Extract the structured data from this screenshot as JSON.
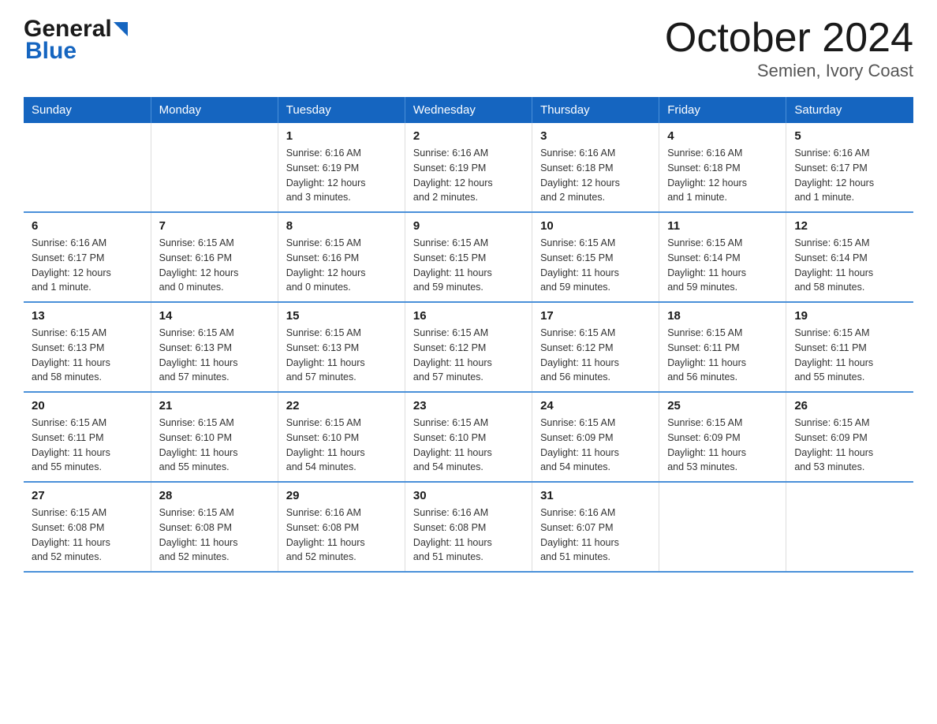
{
  "logo": {
    "general": "General",
    "triangle_char": "▶",
    "blue": "Blue"
  },
  "title": "October 2024",
  "location": "Semien, Ivory Coast",
  "weekdays": [
    "Sunday",
    "Monday",
    "Tuesday",
    "Wednesday",
    "Thursday",
    "Friday",
    "Saturday"
  ],
  "weeks": [
    [
      {
        "day": "",
        "info": ""
      },
      {
        "day": "",
        "info": ""
      },
      {
        "day": "1",
        "info": "Sunrise: 6:16 AM\nSunset: 6:19 PM\nDaylight: 12 hours\nand 3 minutes."
      },
      {
        "day": "2",
        "info": "Sunrise: 6:16 AM\nSunset: 6:19 PM\nDaylight: 12 hours\nand 2 minutes."
      },
      {
        "day": "3",
        "info": "Sunrise: 6:16 AM\nSunset: 6:18 PM\nDaylight: 12 hours\nand 2 minutes."
      },
      {
        "day": "4",
        "info": "Sunrise: 6:16 AM\nSunset: 6:18 PM\nDaylight: 12 hours\nand 1 minute."
      },
      {
        "day": "5",
        "info": "Sunrise: 6:16 AM\nSunset: 6:17 PM\nDaylight: 12 hours\nand 1 minute."
      }
    ],
    [
      {
        "day": "6",
        "info": "Sunrise: 6:16 AM\nSunset: 6:17 PM\nDaylight: 12 hours\nand 1 minute."
      },
      {
        "day": "7",
        "info": "Sunrise: 6:15 AM\nSunset: 6:16 PM\nDaylight: 12 hours\nand 0 minutes."
      },
      {
        "day": "8",
        "info": "Sunrise: 6:15 AM\nSunset: 6:16 PM\nDaylight: 12 hours\nand 0 minutes."
      },
      {
        "day": "9",
        "info": "Sunrise: 6:15 AM\nSunset: 6:15 PM\nDaylight: 11 hours\nand 59 minutes."
      },
      {
        "day": "10",
        "info": "Sunrise: 6:15 AM\nSunset: 6:15 PM\nDaylight: 11 hours\nand 59 minutes."
      },
      {
        "day": "11",
        "info": "Sunrise: 6:15 AM\nSunset: 6:14 PM\nDaylight: 11 hours\nand 59 minutes."
      },
      {
        "day": "12",
        "info": "Sunrise: 6:15 AM\nSunset: 6:14 PM\nDaylight: 11 hours\nand 58 minutes."
      }
    ],
    [
      {
        "day": "13",
        "info": "Sunrise: 6:15 AM\nSunset: 6:13 PM\nDaylight: 11 hours\nand 58 minutes."
      },
      {
        "day": "14",
        "info": "Sunrise: 6:15 AM\nSunset: 6:13 PM\nDaylight: 11 hours\nand 57 minutes."
      },
      {
        "day": "15",
        "info": "Sunrise: 6:15 AM\nSunset: 6:13 PM\nDaylight: 11 hours\nand 57 minutes."
      },
      {
        "day": "16",
        "info": "Sunrise: 6:15 AM\nSunset: 6:12 PM\nDaylight: 11 hours\nand 57 minutes."
      },
      {
        "day": "17",
        "info": "Sunrise: 6:15 AM\nSunset: 6:12 PM\nDaylight: 11 hours\nand 56 minutes."
      },
      {
        "day": "18",
        "info": "Sunrise: 6:15 AM\nSunset: 6:11 PM\nDaylight: 11 hours\nand 56 minutes."
      },
      {
        "day": "19",
        "info": "Sunrise: 6:15 AM\nSunset: 6:11 PM\nDaylight: 11 hours\nand 55 minutes."
      }
    ],
    [
      {
        "day": "20",
        "info": "Sunrise: 6:15 AM\nSunset: 6:11 PM\nDaylight: 11 hours\nand 55 minutes."
      },
      {
        "day": "21",
        "info": "Sunrise: 6:15 AM\nSunset: 6:10 PM\nDaylight: 11 hours\nand 55 minutes."
      },
      {
        "day": "22",
        "info": "Sunrise: 6:15 AM\nSunset: 6:10 PM\nDaylight: 11 hours\nand 54 minutes."
      },
      {
        "day": "23",
        "info": "Sunrise: 6:15 AM\nSunset: 6:10 PM\nDaylight: 11 hours\nand 54 minutes."
      },
      {
        "day": "24",
        "info": "Sunrise: 6:15 AM\nSunset: 6:09 PM\nDaylight: 11 hours\nand 54 minutes."
      },
      {
        "day": "25",
        "info": "Sunrise: 6:15 AM\nSunset: 6:09 PM\nDaylight: 11 hours\nand 53 minutes."
      },
      {
        "day": "26",
        "info": "Sunrise: 6:15 AM\nSunset: 6:09 PM\nDaylight: 11 hours\nand 53 minutes."
      }
    ],
    [
      {
        "day": "27",
        "info": "Sunrise: 6:15 AM\nSunset: 6:08 PM\nDaylight: 11 hours\nand 52 minutes."
      },
      {
        "day": "28",
        "info": "Sunrise: 6:15 AM\nSunset: 6:08 PM\nDaylight: 11 hours\nand 52 minutes."
      },
      {
        "day": "29",
        "info": "Sunrise: 6:16 AM\nSunset: 6:08 PM\nDaylight: 11 hours\nand 52 minutes."
      },
      {
        "day": "30",
        "info": "Sunrise: 6:16 AM\nSunset: 6:08 PM\nDaylight: 11 hours\nand 51 minutes."
      },
      {
        "day": "31",
        "info": "Sunrise: 6:16 AM\nSunset: 6:07 PM\nDaylight: 11 hours\nand 51 minutes."
      },
      {
        "day": "",
        "info": ""
      },
      {
        "day": "",
        "info": ""
      }
    ]
  ]
}
